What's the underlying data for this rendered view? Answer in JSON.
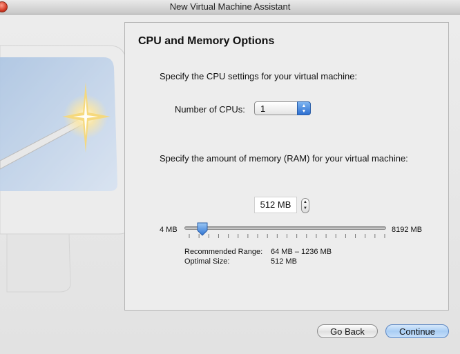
{
  "window": {
    "title": "New Virtual Machine Assistant"
  },
  "panel": {
    "title": "CPU and Memory Options",
    "cpu": {
      "prompt": "Specify the CPU settings for your virtual machine:",
      "label": "Number of CPUs:",
      "selected": "1"
    },
    "memory": {
      "prompt": "Specify the amount of memory (RAM) for your virtual machine:",
      "value": "512 MB",
      "slider_min_label": "4 MB",
      "slider_max_label": "8192 MB",
      "slider_value_mb": 512,
      "slider_min_mb": 4,
      "slider_max_mb": 8192,
      "recommended_label": "Recommended Range:",
      "recommended_value": "64 MB – 1236 MB",
      "optimal_label": "Optimal Size:",
      "optimal_value": "512 MB"
    }
  },
  "buttons": {
    "back": "Go Back",
    "continue": "Continue"
  },
  "colors": {
    "accent": "#2d6fd1",
    "default_button": "#a9cdf4"
  }
}
